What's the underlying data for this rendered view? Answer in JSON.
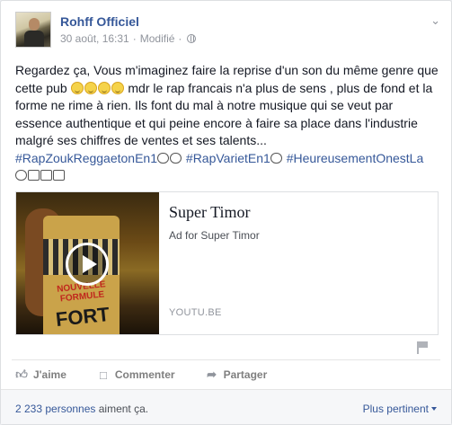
{
  "post": {
    "author": "Rohff Officiel",
    "date": "30 août, 16:31",
    "separator": "·",
    "edited": "Modifié",
    "text_part1": "Regardez ça, Vous m'imaginez faire la reprise d'un son du même genre que cette pub ",
    "text_part2": " mdr le rap francais n'a plus de sens , plus de fond et la forme ne rime à rien. Ils font du mal à notre musique qui se veut par essence authentique et qui peine encore à faire sa place dans l'industrie malgré ses chiffres de ventes et ses talents...",
    "hashtag1": "#RapZoukReggaetonEn1",
    "hashtag2": "#RapVarietEn1",
    "hashtag3": "#HeureusementOnestLa"
  },
  "attachment": {
    "title": "Super Timor",
    "description": "Ad for Super Timor",
    "domain": "YOUTU.BE",
    "thumb_text": "NOUVELLE FORMULE",
    "thumb_word": "FORT"
  },
  "actions": {
    "like": "J'aime",
    "comment": "Commenter",
    "share": "Partager"
  },
  "footer": {
    "likes_count": "2 233 personnes",
    "likes_suffix": " aiment ça.",
    "sort_label": "Plus pertinent"
  },
  "icons": {
    "like": "thumbs-up-icon",
    "comment": "speech-bubble-icon",
    "share": "share-arrow-icon",
    "audience": "globe-icon",
    "options": "chevron-down-icon",
    "report": "flag-icon",
    "play": "play-icon"
  },
  "colors": {
    "link": "#365899",
    "secondary_text": "#90949c",
    "footer_bg": "#f6f7f9"
  }
}
